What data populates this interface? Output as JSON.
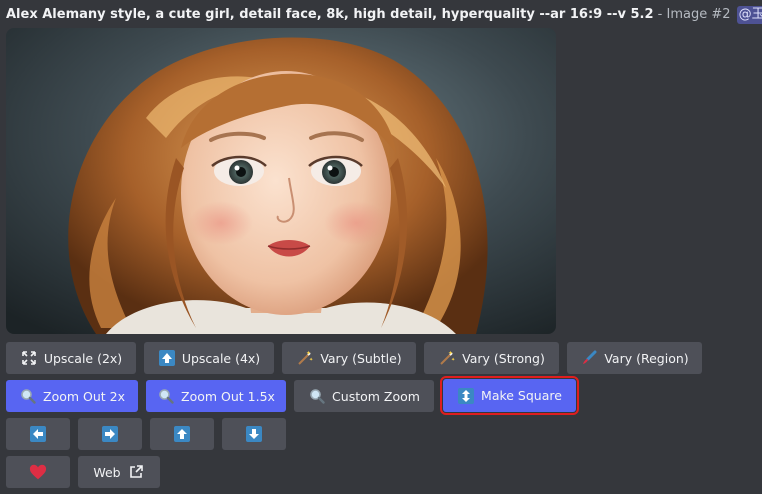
{
  "message": {
    "prompt": "Alex Alemany style, a cute girl, detail face, 8k, high detail, hyperquality --ar 16:9 --v 5.2",
    "separator": " - ",
    "image_label": "Image #2",
    "mention": "@玉儿"
  },
  "image": {
    "alt_icon": "generated-portrait-image"
  },
  "buttons": {
    "row1": [
      {
        "label": "Upscale (2x)",
        "icon": "expand-arrows-icon"
      },
      {
        "label": "Upscale (4x)",
        "icon": "upload-arrow-icon"
      },
      {
        "label": "Vary (Subtle)",
        "icon": "magic-wand-icon"
      },
      {
        "label": "Vary (Strong)",
        "icon": "magic-wand-icon"
      },
      {
        "label": "Vary (Region)",
        "icon": "paintbrush-icon"
      }
    ],
    "row2": [
      {
        "label": "Zoom Out 2x",
        "icon": "magnifier-icon"
      },
      {
        "label": "Zoom Out 1.5x",
        "icon": "magnifier-icon"
      },
      {
        "label": "Custom Zoom",
        "icon": "magnifier-icon"
      },
      {
        "label": "Make Square",
        "icon": "up-down-arrow-icon"
      }
    ],
    "row3": [
      {
        "icon": "arrow-left-icon"
      },
      {
        "icon": "arrow-right-icon"
      },
      {
        "icon": "arrow-up-icon"
      },
      {
        "icon": "arrow-down-icon"
      }
    ],
    "row4": [
      {
        "icon": "heart-icon"
      },
      {
        "label": "Web",
        "icon": "external-link-icon"
      }
    ]
  },
  "colors": {
    "background": "#35373c",
    "button_secondary": "#4e5058",
    "button_primary": "#5865f2",
    "highlight_outline": "#e01e1e",
    "mention_bg": "#4e5294"
  }
}
